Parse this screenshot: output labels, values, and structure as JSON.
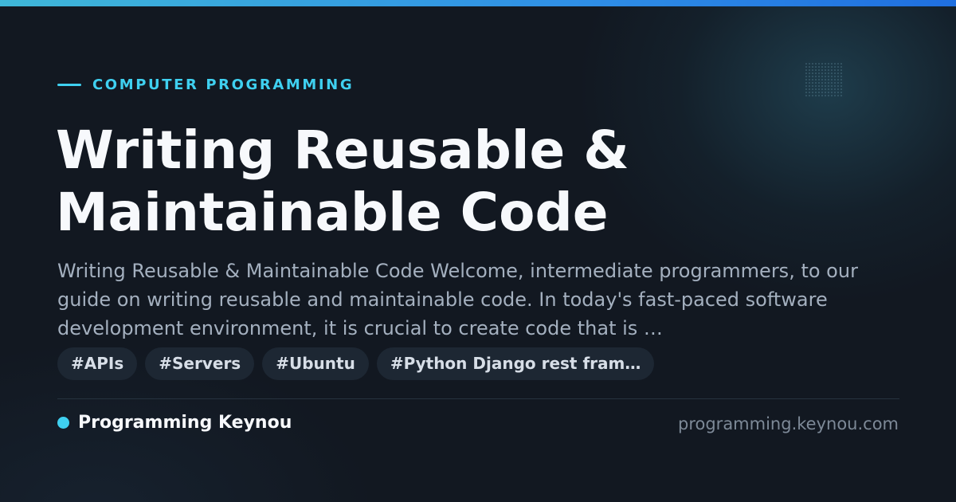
{
  "category": "COMPUTER PROGRAMMING",
  "title_line1": "Writing Reusable &",
  "title_line2": "Maintainable Code",
  "description": "Writing Reusable & Maintainable Code Welcome, intermediate programmers, to our guide on writing reusable and maintainable code. In today's fast-paced software development environment, it is crucial to create code that is …",
  "tags": [
    "#APIs",
    "#Servers",
    "#Ubuntu",
    "#Python Django rest fram…"
  ],
  "brand": "Programming Keynou",
  "domain": "programming.keynou.com",
  "colors": {
    "background": "#121821",
    "accent": "#3fd0f0",
    "title": "#f7f9fc",
    "description": "#a4b0bf",
    "tag_bg": "#1d2733",
    "domain": "#7d8997"
  }
}
